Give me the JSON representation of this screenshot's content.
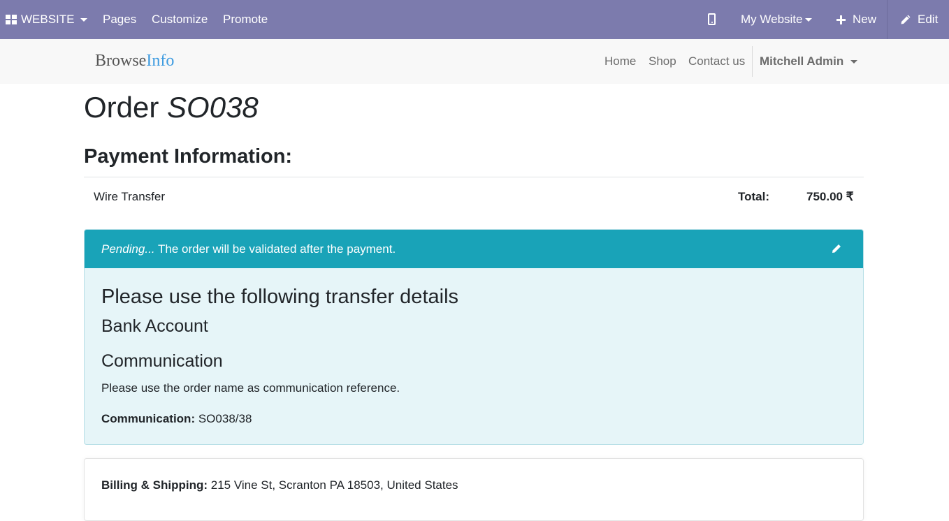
{
  "admin_bar": {
    "app_label": "WEBSITE",
    "pages": "Pages",
    "customize": "Customize",
    "promote": "Promote",
    "my_website": "My Website",
    "new": "New",
    "edit": "Edit",
    "color": "#7c7bad"
  },
  "site_header": {
    "logo_part1": "Browse",
    "logo_part2": "Info",
    "nav": {
      "home": "Home",
      "shop": "Shop",
      "contact": "Contact us"
    },
    "user": "Mitchell Admin"
  },
  "order": {
    "title_prefix": "Order",
    "number": "SO038"
  },
  "payment": {
    "heading": "Payment Information:",
    "method": "Wire Transfer",
    "total_label": "Total:",
    "total_value": "750.00 ₹"
  },
  "alert": {
    "pending": "Pending...",
    "message": " The order will be validated after the payment.",
    "header_color": "#19a3b8",
    "transfer_heading": "Please use the following transfer details",
    "bank_heading": "Bank Account",
    "comm_heading": "Communication",
    "comm_instruction": "Please use the order name as communication reference.",
    "comm_label": "Communication:",
    "comm_value": "SO038/38"
  },
  "billing": {
    "label": "Billing & Shipping:",
    "address": "215 Vine St, Scranton PA 18503, United States"
  }
}
